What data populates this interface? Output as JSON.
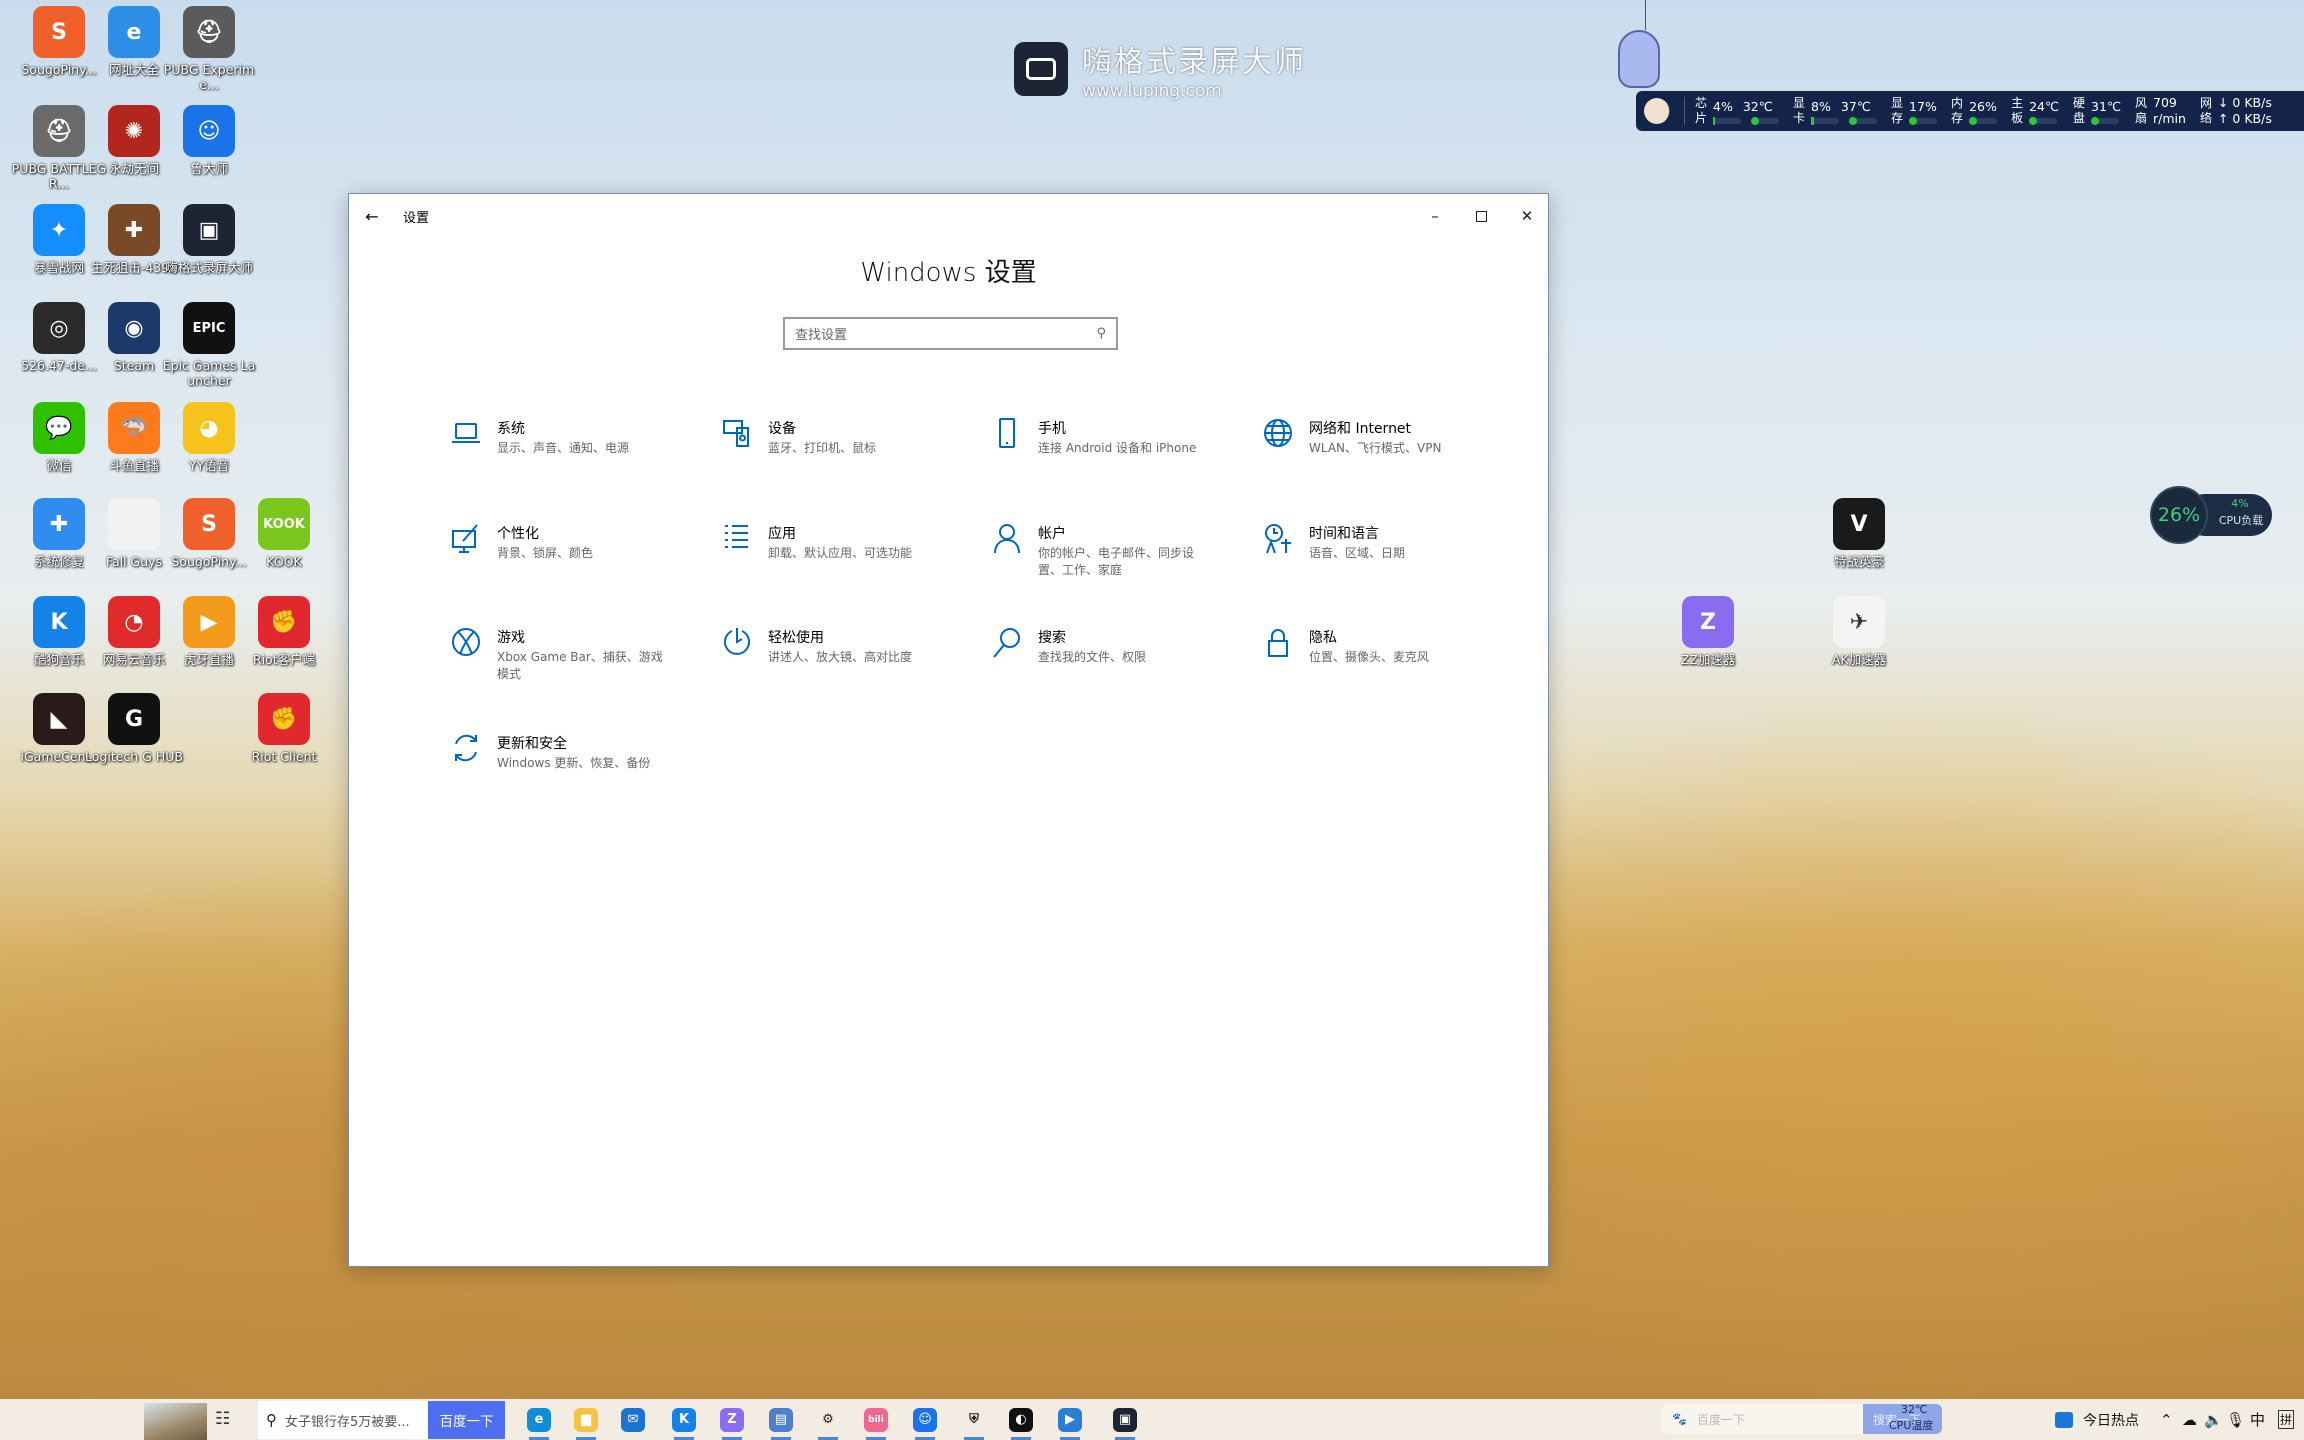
{
  "watermark": {
    "title": "嗨格式录屏大师",
    "url": "www.luping.com"
  },
  "monitor": {
    "cpu": {
      "label": [
        "芯",
        "片"
      ],
      "usage": "4%",
      "temp": "32℃",
      "usage_fraction": 0.04
    },
    "gpu": {
      "label": [
        "显",
        "卡"
      ],
      "usage": "8%",
      "temp": "37℃",
      "usage_fraction": 0.08
    },
    "vram": {
      "label": [
        "显",
        "存"
      ],
      "usage": "17%"
    },
    "ram": {
      "label": [
        "内",
        "存"
      ],
      "usage": "26%"
    },
    "board": {
      "label": [
        "主",
        "板"
      ],
      "temp": "24℃"
    },
    "disk": {
      "label": [
        "硬",
        "盘"
      ],
      "temp": "31℃"
    },
    "fan": {
      "label": [
        "风",
        "扇"
      ],
      "value": "709",
      "unit": "r/min"
    },
    "net": {
      "label": [
        "网",
        "络"
      ],
      "down": "↓ 0 KB/s",
      "up": "↑ 0 KB/s"
    }
  },
  "cpu_widget": {
    "ring": "26%",
    "load": "4%",
    "label": "CPU负载"
  },
  "desktop_icons": [
    {
      "label": "SougoPiny...",
      "color": "#f0602a",
      "glyph": "S"
    },
    {
      "label": "网址大全",
      "color": "#2d8ee6",
      "glyph": "e"
    },
    {
      "label": "PUBG Experime...",
      "color": "#5b5b5b",
      "glyph": "⛑"
    },
    {
      "label": "PUBG BATTLEGR...",
      "color": "#6a6a6a",
      "glyph": "⛑"
    },
    {
      "label": "永劫无间",
      "color": "#b3261e",
      "glyph": "✺"
    },
    {
      "label": "鲁大师",
      "color": "#1a73e8",
      "glyph": "☺"
    },
    {
      "label": "暴雪战网",
      "color": "#148eff",
      "glyph": "✦"
    },
    {
      "label": "生死狙击-4399",
      "color": "#7a4a28",
      "glyph": "✚"
    },
    {
      "label": "嗨格式录屏大师",
      "color": "#1d2433",
      "glyph": "▣"
    },
    {
      "label": "526.47-de...",
      "color": "#2b2b2b",
      "glyph": "◎"
    },
    {
      "label": "Steam",
      "color": "#1b3a6b",
      "glyph": "◉"
    },
    {
      "label": "Epic Games Launcher",
      "color": "#111111",
      "glyph": "EPIC"
    },
    {
      "label": "微信",
      "color": "#2dc100",
      "glyph": "💬"
    },
    {
      "label": "斗鱼直播",
      "color": "#ff7a1a",
      "glyph": "🦈"
    },
    {
      "label": "YY语音",
      "color": "#f6c21c",
      "glyph": "◕"
    },
    {
      "label": "系统修复",
      "color": "#2f8cf0",
      "glyph": "✚"
    },
    {
      "label": "Fall Guys",
      "color": "#f2f2f2",
      "glyph": ""
    },
    {
      "label": "SougoPiny...",
      "color": "#f0602a",
      "glyph": "S"
    },
    {
      "label": "KOOK",
      "color": "#7ac61d",
      "glyph": "KOOK"
    },
    {
      "label": "酷狗音乐",
      "color": "#1582ea",
      "glyph": "K"
    },
    {
      "label": "网易云音乐",
      "color": "#e12a2a",
      "glyph": "◔"
    },
    {
      "label": "虎牙直播",
      "color": "#f59b1c",
      "glyph": "▶"
    },
    {
      "label": "Riot客户端",
      "color": "#e0282e",
      "glyph": "✊"
    },
    {
      "label": "iGameCen...",
      "color": "#2a1a1a",
      "glyph": "◣"
    },
    {
      "label": "Logitech G HUB",
      "color": "#111111",
      "glyph": "G"
    },
    {
      "label": "Riot Client",
      "color": "#e0282e",
      "glyph": "✊"
    },
    {
      "label": "特战英豪",
      "color": "#1a1a1a",
      "glyph": "V"
    },
    {
      "label": "ZZ加速器",
      "color": "#8a6cf0",
      "glyph": "Z"
    },
    {
      "label": "AK加速器",
      "color": "#f4f4f4",
      "glyph": "✈"
    }
  ],
  "settings": {
    "window_title": "设置",
    "heading": "Windows 设置",
    "search_placeholder": "查找设置",
    "accent": "#0067c0",
    "items": [
      {
        "title": "系统",
        "desc": "显示、声音、通知、电源",
        "icon": "laptop-icon"
      },
      {
        "title": "设备",
        "desc": "蓝牙、打印机、鼠标",
        "icon": "devices-icon"
      },
      {
        "title": "手机",
        "desc": "连接 Android 设备和 iPhone",
        "icon": "phone-icon"
      },
      {
        "title": "网络和 Internet",
        "desc": "WLAN、飞行模式、VPN",
        "icon": "globe-icon"
      },
      {
        "title": "个性化",
        "desc": "背景、锁屏、颜色",
        "icon": "paint-icon"
      },
      {
        "title": "应用",
        "desc": "卸载、默认应用、可选功能",
        "icon": "apps-list-icon"
      },
      {
        "title": "帐户",
        "desc": "你的帐户、电子邮件、同步设置、工作、家庭",
        "icon": "person-icon"
      },
      {
        "title": "时间和语言",
        "desc": "语音、区域、日期",
        "icon": "time-language-icon"
      },
      {
        "title": "游戏",
        "desc": "Xbox Game Bar、捕获、游戏模式",
        "icon": "xbox-icon"
      },
      {
        "title": "轻松使用",
        "desc": "讲述人、放大镜、高对比度",
        "icon": "ease-of-access-icon"
      },
      {
        "title": "搜索",
        "desc": "查找我的文件、权限",
        "icon": "search-icon"
      },
      {
        "title": "隐私",
        "desc": "位置、摄像头、麦克风",
        "icon": "lock-icon"
      },
      {
        "title": "更新和安全",
        "desc": "Windows 更新、恢复、备份",
        "icon": "sync-icon"
      }
    ]
  },
  "taskbar": {
    "search_text": "女子银行存5万被要...",
    "search_button": "百度一下",
    "apps": [
      {
        "name": "edge",
        "color": "#0f8dd6",
        "glyph": "e",
        "active": true
      },
      {
        "name": "file-explorer",
        "color": "#f5c242",
        "glyph": "▆",
        "active": true
      },
      {
        "name": "mail",
        "color": "#1a74d2",
        "glyph": "✉",
        "active": false
      },
      {
        "name": "kugou",
        "color": "#1582ea",
        "glyph": "K",
        "active": true
      },
      {
        "name": "zz-accelerator",
        "color": "#8a6cf0",
        "glyph": "Z",
        "active": true
      },
      {
        "name": "computer-tool",
        "color": "#4f7fc8",
        "glyph": "▤",
        "active": true
      },
      {
        "name": "settings",
        "color": "#f3ece2",
        "glyph": "⚙",
        "active": true
      },
      {
        "name": "bilibili",
        "color": "#f0688f",
        "glyph": "bili",
        "active": true
      },
      {
        "name": "ludashi",
        "color": "#1a73e8",
        "glyph": "☺",
        "active": true
      },
      {
        "name": "security",
        "color": "#f3ece2",
        "glyph": "⛨",
        "active": true
      },
      {
        "name": "steam-like",
        "color": "#111",
        "glyph": "◐",
        "active": true
      },
      {
        "name": "media-player",
        "color": "#2a7fd4",
        "glyph": "▶",
        "active": true
      },
      {
        "name": "screen-recorder",
        "color": "#1d2433",
        "glyph": "▣",
        "active": true
      }
    ],
    "baidu_placeholder": "百度一下",
    "baidu_button": "搜索一下",
    "cpu_temp": "32℃",
    "cpu_temp_label": "CPU温度",
    "news": "今日热点",
    "ime": "中",
    "ime_mode": "拼"
  }
}
